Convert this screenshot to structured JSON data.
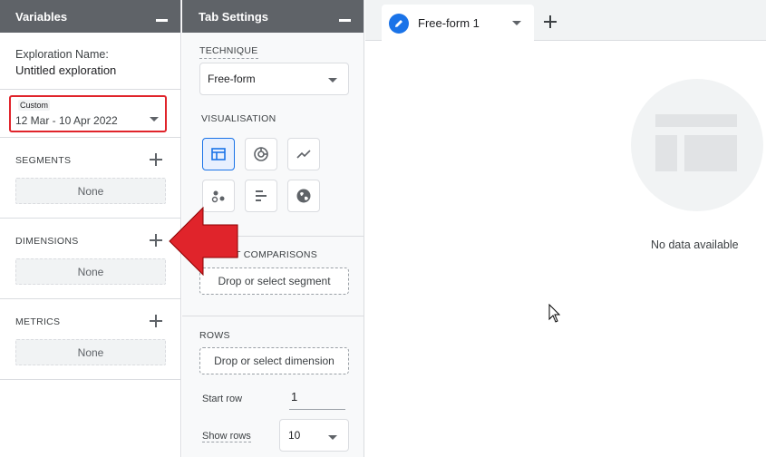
{
  "variables": {
    "title": "Variables",
    "exploration_name_label": "Exploration Name:",
    "exploration_name_value": "Untitled exploration",
    "date_range": {
      "label": "Custom",
      "value": "12 Mar - 10 Apr 2022"
    },
    "segments": {
      "title": "SEGMENTS",
      "empty": "None"
    },
    "dimensions": {
      "title": "DIMENSIONS",
      "empty": "None"
    },
    "metrics": {
      "title": "METRICS",
      "empty": "None"
    }
  },
  "tab_settings": {
    "title": "Tab Settings",
    "technique_label": "TECHNIQUE",
    "technique_value": "Free-form",
    "visualisation_label": "VISUALISATION",
    "visualisation_options": [
      "table-icon",
      "donut-chart-icon",
      "line-chart-icon",
      "scatter-plot-icon",
      "bar-chart-icon",
      "geo-map-icon"
    ],
    "segment_comparisons_label": "T COMPARISONS",
    "segment_drop": "Drop or select segment",
    "rows_label": "ROWS",
    "rows_drop": "Drop or select dimension",
    "start_row_label": "Start row",
    "start_row_value": "1",
    "show_rows_label": "Show rows",
    "show_rows_value": "10"
  },
  "canvas": {
    "tab_name": "Free-form 1",
    "no_data": "No data available"
  },
  "colors": {
    "header_bg": "#5f6368",
    "accent": "#1a73e8",
    "highlight_red": "#e0242b"
  }
}
